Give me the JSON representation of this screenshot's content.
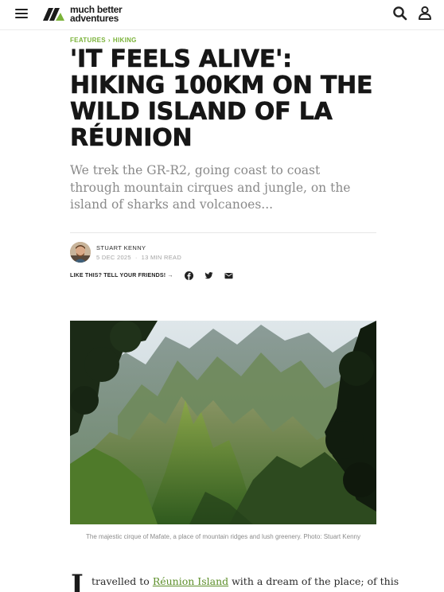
{
  "header": {
    "logo_line1": "much better",
    "logo_line2": "adventures",
    "icons": [
      "menu-icon",
      "search-icon",
      "user-icon"
    ]
  },
  "article": {
    "breadcrumb": [
      "FEATURES",
      "HIKING"
    ],
    "breadcrumb_separator": "›",
    "title_lines": [
      "'IT FEELS ALIVE':",
      "HIKING 100KM ON THE",
      "WILD ISLAND OF LA",
      "RÉUNION"
    ],
    "standfirst": "We trek the GR-R2, going coast to coast through mountain cirques and jungle, on the island of sharks and volcanoes...",
    "author": "STUART KENNY",
    "date": "5 DEC 2025",
    "read_time": "13 MIN READ",
    "meta_separator": "·",
    "share_label": "LIKE THIS? TELL YOUR FRIENDS! →",
    "share_icons": [
      "facebook-icon",
      "twitter-icon",
      "email-icon"
    ],
    "image_caption": "The majestic cirque of Mafate, a place of mountain ridges and lush greenery. Photo: Stuart Kenny",
    "dropcap": "I",
    "body_start": "travelled to ",
    "body_link": "Réunion Island",
    "body_rest": " with a dream of the place; of this"
  },
  "colors": {
    "accent_green": "#7bb33a",
    "title": "#161616",
    "standfirst": "#8a8a8a"
  }
}
